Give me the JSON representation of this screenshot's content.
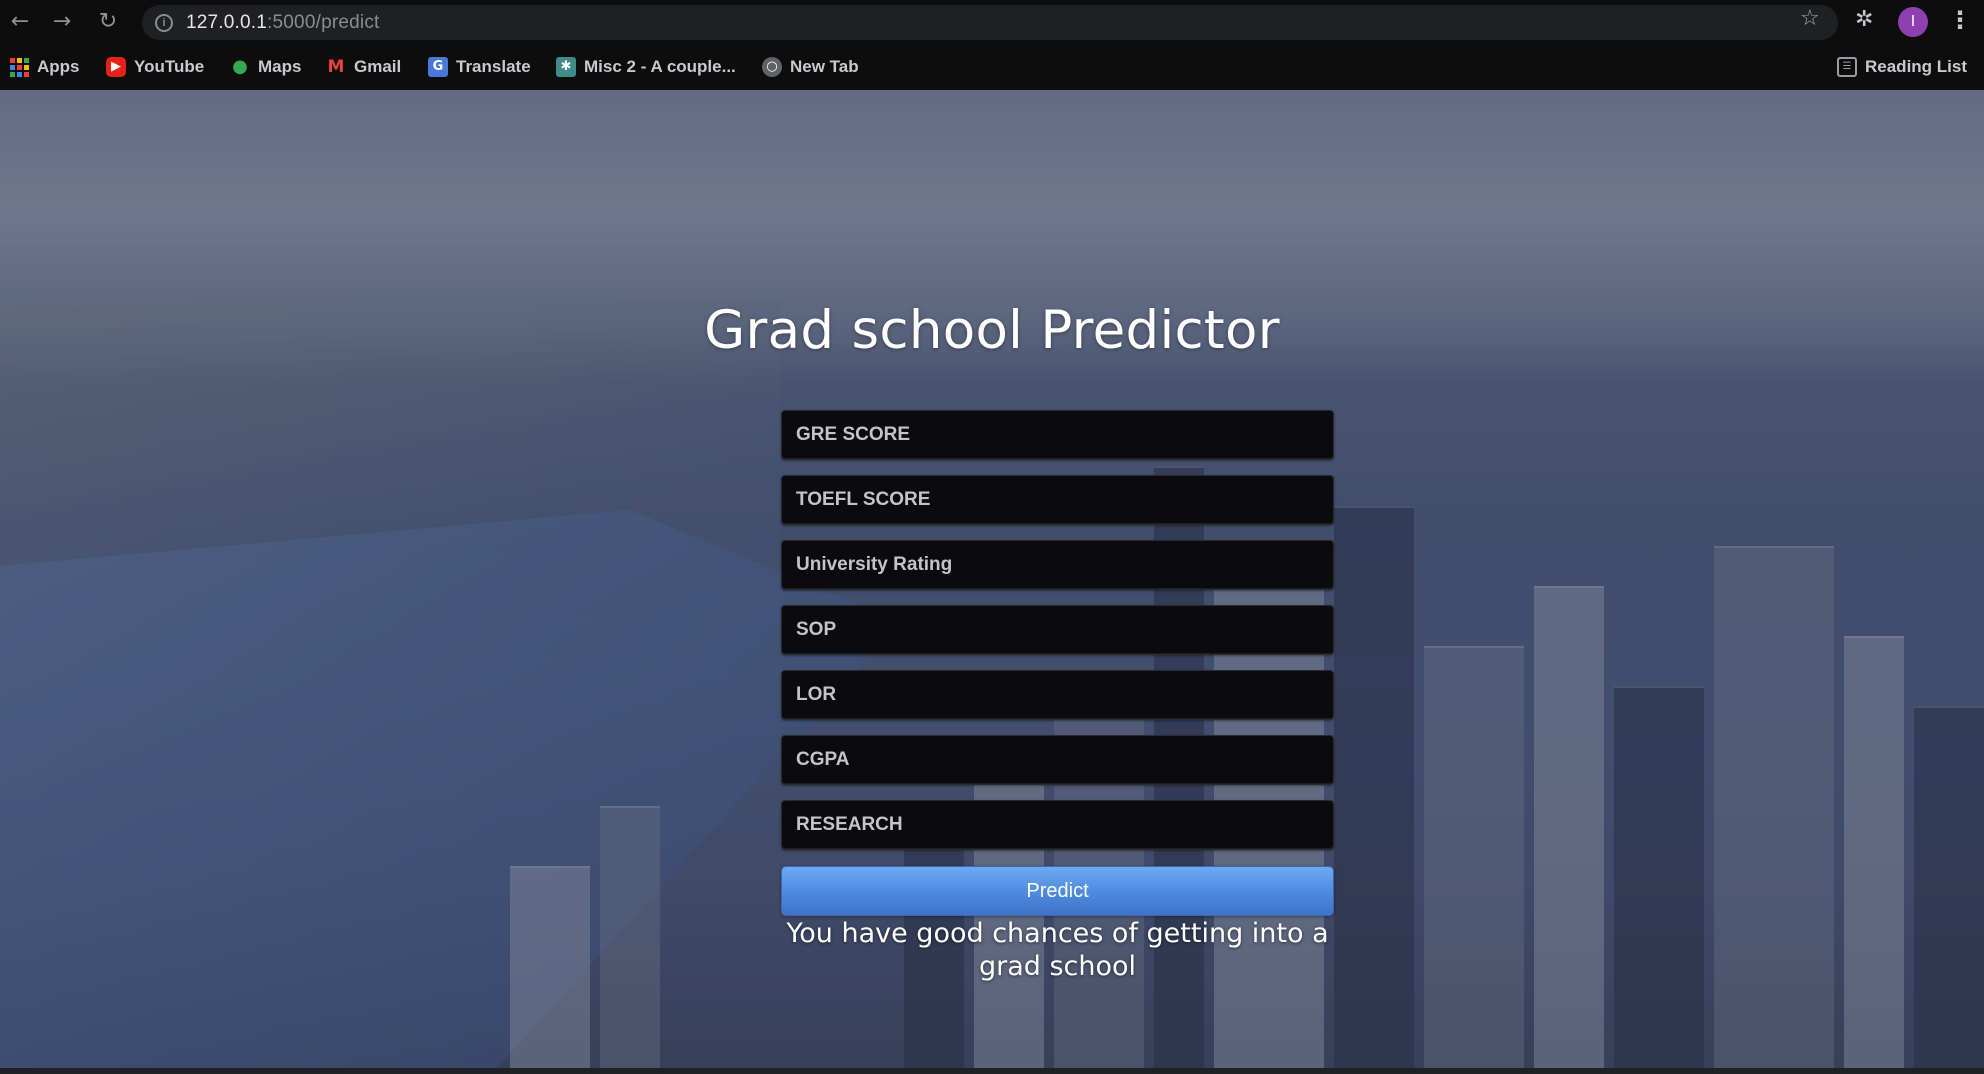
{
  "browser": {
    "url_host": "127.0.0.1",
    "url_path": ":5000/predict",
    "profile_initial": "I",
    "bookmarks": [
      {
        "label": "Apps",
        "icon": "apps-grid-icon"
      },
      {
        "label": "YouTube",
        "icon": "youtube-icon"
      },
      {
        "label": "Maps",
        "icon": "maps-pin-icon"
      },
      {
        "label": "Gmail",
        "icon": "gmail-icon"
      },
      {
        "label": "Translate",
        "icon": "translate-icon"
      },
      {
        "label": "Misc 2 - A couple...",
        "icon": "folder-icon"
      },
      {
        "label": "New Tab",
        "icon": "globe-icon"
      }
    ],
    "reading_list_label": "Reading List"
  },
  "page": {
    "title": "Grad school Predictor",
    "fields": {
      "gre": {
        "placeholder": "GRE SCORE",
        "value": ""
      },
      "toefl": {
        "placeholder": "TOEFL SCORE",
        "value": ""
      },
      "university_rating": {
        "placeholder": "University Rating",
        "value": ""
      },
      "sop": {
        "placeholder": "SOP",
        "value": ""
      },
      "lor": {
        "placeholder": "LOR",
        "value": ""
      },
      "cgpa": {
        "placeholder": "CGPA",
        "value": ""
      },
      "research": {
        "placeholder": "RESEARCH",
        "value": ""
      }
    },
    "predict_label": "Predict",
    "result_text": "You have good chances of getting into a grad school"
  },
  "colors": {
    "field_bg": "#0b0b0d",
    "button_blue": "#4f8ce0",
    "avatar_purple": "#8e3fb0"
  }
}
